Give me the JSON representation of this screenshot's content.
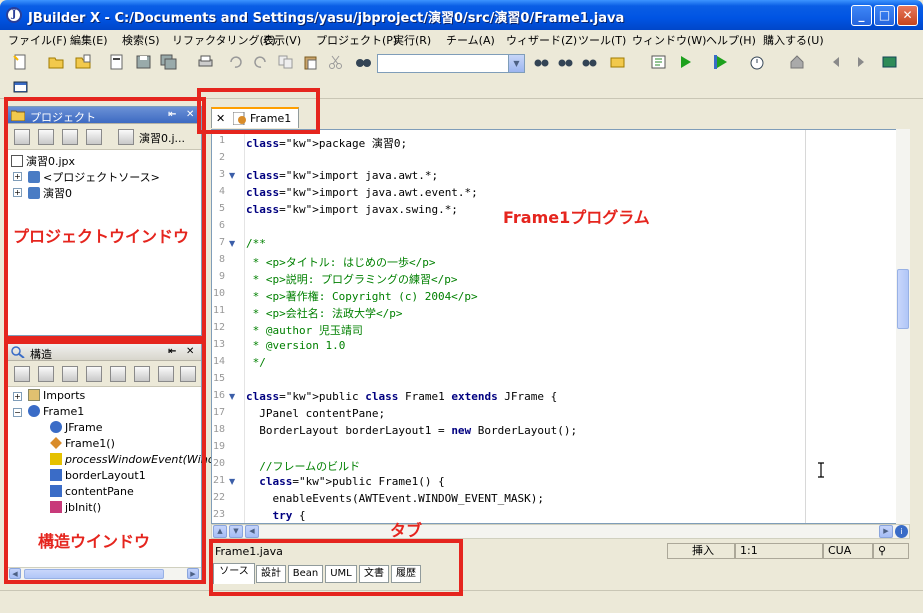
{
  "window": {
    "title": "JBuilder X - C:/Documents and Settings/yasu/jbproject/演習0/src/演習0/Frame1.java",
    "app_icon": "jbuilder-icon",
    "minimize": "_",
    "maximize": "□",
    "close": "✕"
  },
  "menu": [
    "ファイル(F)",
    "編集(E)",
    "検索(S)",
    "リファクタリング(C)",
    "表示(V)",
    "プロジェクト(P)",
    "実行(R)",
    "チーム(A)",
    "ウィザード(Z)",
    "ツール(T)",
    "ウィンドウ(W)",
    "ヘルプ(H)",
    "購入する(U)"
  ],
  "project_panel": {
    "title": "プロジェクト",
    "project_selector": "演習0.j...",
    "tree": [
      {
        "label": "演習0.jpx",
        "level": 0
      },
      {
        "label": "<プロジェクトソース>",
        "level": 1
      },
      {
        "label": "演習0",
        "level": 1
      }
    ]
  },
  "structure_panel": {
    "title": "構造",
    "tree": [
      {
        "label": "Imports",
        "level": 0
      },
      {
        "label": "Frame1",
        "level": 0
      },
      {
        "label": "JFrame",
        "level": 1
      },
      {
        "label": "Frame1()",
        "level": 1
      },
      {
        "label": "processWindowEvent(Wind",
        "level": 1
      },
      {
        "label": "borderLayout1",
        "level": 1
      },
      {
        "label": "contentPane",
        "level": 1
      },
      {
        "label": "jbInit()",
        "level": 1
      }
    ]
  },
  "editor": {
    "tab_label": "Frame1",
    "tab_close": "✕",
    "lines": [
      {
        "n": "1",
        "text": "package 演習0;"
      },
      {
        "n": "2",
        "text": ""
      },
      {
        "n": "3",
        "text": "import java.awt.*;"
      },
      {
        "n": "4",
        "text": "import java.awt.event.*;"
      },
      {
        "n": "5",
        "text": "import javax.swing.*;"
      },
      {
        "n": "6",
        "text": ""
      },
      {
        "n": "7",
        "text": "/**"
      },
      {
        "n": "8",
        "text": " * <p>タイトル: はじめの一歩</p>"
      },
      {
        "n": "9",
        "text": " * <p>説明: プログラミングの練習</p>"
      },
      {
        "n": "10",
        "text": " * <p>著作権: Copyright (c) 2004</p>"
      },
      {
        "n": "11",
        "text": " * <p>会社名: 法政大学</p>"
      },
      {
        "n": "12",
        "text": " * @author 児玉靖司"
      },
      {
        "n": "13",
        "text": " * @version 1.0"
      },
      {
        "n": "14",
        "text": " */"
      },
      {
        "n": "15",
        "text": ""
      },
      {
        "n": "16",
        "text": "public class Frame1 extends JFrame {"
      },
      {
        "n": "17",
        "text": "  JPanel contentPane;"
      },
      {
        "n": "18",
        "text": "  BorderLayout borderLayout1 = new BorderLayout();"
      },
      {
        "n": "19",
        "text": ""
      },
      {
        "n": "20",
        "text": "  //フレームのビルド"
      },
      {
        "n": "21",
        "text": "  public Frame1() {"
      },
      {
        "n": "22",
        "text": "    enableEvents(AWTEvent.WINDOW_EVENT_MASK);"
      },
      {
        "n": "23",
        "text": "    try {"
      }
    ]
  },
  "status": {
    "file": "Frame1.java",
    "mode": "挿入",
    "position": "1:1",
    "keymap": "CUA"
  },
  "bottom_tabs": [
    "ソース",
    "設計",
    "Bean",
    "UML",
    "文書",
    "履歴"
  ],
  "annotations": {
    "project_window": "プロジェクトウインドウ",
    "structure_window": "構造ウインドウ",
    "program": "Frame1プログラム",
    "tab": "タブ"
  },
  "colors": {
    "annotation_red": "#e5251e",
    "titlebar_blue": "#0054e3"
  }
}
